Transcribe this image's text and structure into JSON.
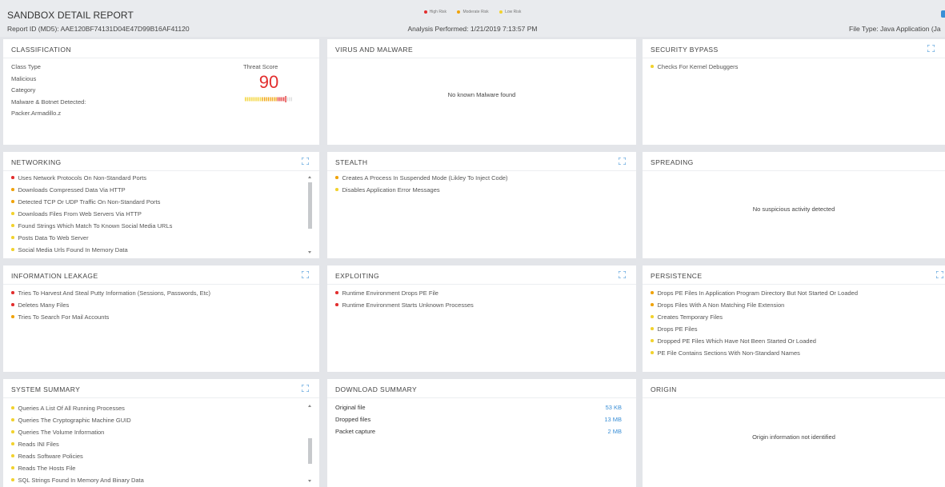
{
  "header": {
    "title": "SANDBOX DETAIL REPORT",
    "report_id": "Report ID (MD5): AAE120BF74131D04E47D99B16AF41120",
    "analysis": "Analysis Performed: 1/21/2019 7:13:57 PM",
    "file_type": "File Type: Java Application (Ja",
    "legend": [
      {
        "label": "High Risk",
        "color": "#e22e2e"
      },
      {
        "label": "Moderate Risk",
        "color": "#f0a30a"
      },
      {
        "label": "Low Risk",
        "color": "#f2d22e"
      }
    ]
  },
  "colors": {
    "high": "#e22e2e",
    "moderate": "#f0a30a",
    "low": "#f2d22e",
    "accent": "#3a8fd6"
  },
  "classification": {
    "title": "CLASSIFICATION",
    "class_type_label": "Class Type",
    "class_type_value": "Malicious",
    "category_label": "Category",
    "category_value": "Malware & Botnet Detected:",
    "detail": "Packer.Armadillo.z",
    "threat_label": "Threat Score",
    "threat_score": "90",
    "threat_level": 0.9
  },
  "virus": {
    "title": "VIRUS AND MALWARE",
    "message": "No known Malware found"
  },
  "security_bypass": {
    "title": "SECURITY BYPASS",
    "items": [
      {
        "text": "Checks For Kernel Debuggers",
        "risk": "low"
      }
    ]
  },
  "networking": {
    "title": "NETWORKING",
    "items": [
      {
        "text": "Uses Network Protocols On Non-Standard Ports",
        "risk": "high"
      },
      {
        "text": "Downloads Compressed Data Via HTTP",
        "risk": "moderate"
      },
      {
        "text": "Detected TCP Or UDP Traffic On Non-Standard Ports",
        "risk": "moderate"
      },
      {
        "text": "Downloads Files From Web Servers Via HTTP",
        "risk": "low"
      },
      {
        "text": "Found Strings Which Match To Known Social Media URLs",
        "risk": "low"
      },
      {
        "text": "Posts Data To Web Server",
        "risk": "low"
      },
      {
        "text": "Social Media Urls Found In Memory Data",
        "risk": "low"
      }
    ]
  },
  "stealth": {
    "title": "STEALTH",
    "items": [
      {
        "text": "Creates A Process In Suspended Mode (Likley To Inject Code)",
        "risk": "moderate"
      },
      {
        "text": "Disables Application Error Messages",
        "risk": "low"
      }
    ]
  },
  "spreading": {
    "title": "SPREADING",
    "message": "No suspicious activity detected"
  },
  "info_leakage": {
    "title": "INFORMATION LEAKAGE",
    "items": [
      {
        "text": "Tries To Harvest And Steal Putty Information (Sessions, Passwords, Etc)",
        "risk": "high"
      },
      {
        "text": "Deletes Many Files",
        "risk": "high"
      },
      {
        "text": "Tries To Search For Mail Accounts",
        "risk": "moderate"
      }
    ]
  },
  "exploiting": {
    "title": "EXPLOITING",
    "items": [
      {
        "text": "Runtime Environment Drops PE File",
        "risk": "high"
      },
      {
        "text": "Runtime Environment Starts Unknown Processes",
        "risk": "high"
      }
    ]
  },
  "persistence": {
    "title": "PERSISTENCE",
    "items": [
      {
        "text": "Drops PE Files In Application Program Directory But Not Started Or Loaded",
        "risk": "moderate"
      },
      {
        "text": "Drops Files With A Non Matching File Extension",
        "risk": "moderate"
      },
      {
        "text": "Creates Temporary Files",
        "risk": "low"
      },
      {
        "text": "Drops PE Files",
        "risk": "low"
      },
      {
        "text": "Dropped PE Files Which Have Not Been Started Or Loaded",
        "risk": "low"
      },
      {
        "text": "PE File Contains Sections With Non-Standard Names",
        "risk": "low"
      }
    ]
  },
  "system_summary": {
    "title": "SYSTEM SUMMARY",
    "items": [
      {
        "text": "Queries A List Of All Running Processes",
        "risk": "low"
      },
      {
        "text": "Queries The Cryptographic Machine GUID",
        "risk": "low"
      },
      {
        "text": "Queries The Volume Information",
        "risk": "low"
      },
      {
        "text": "Reads INI Files",
        "risk": "low"
      },
      {
        "text": "Reads Software Policies",
        "risk": "low"
      },
      {
        "text": "Reads The Hosts File",
        "risk": "low"
      },
      {
        "text": "SQL Strings Found In Memory And Binary Data",
        "risk": "low"
      }
    ]
  },
  "download_summary": {
    "title": "DOWNLOAD SUMMARY",
    "rows": [
      {
        "label": "Original file",
        "value": "53 KB"
      },
      {
        "label": "Dropped files",
        "value": "13 MB"
      },
      {
        "label": "Packet capture",
        "value": "2 MB"
      }
    ]
  },
  "origin": {
    "title": "ORIGIN",
    "message": "Origin information not identified"
  }
}
